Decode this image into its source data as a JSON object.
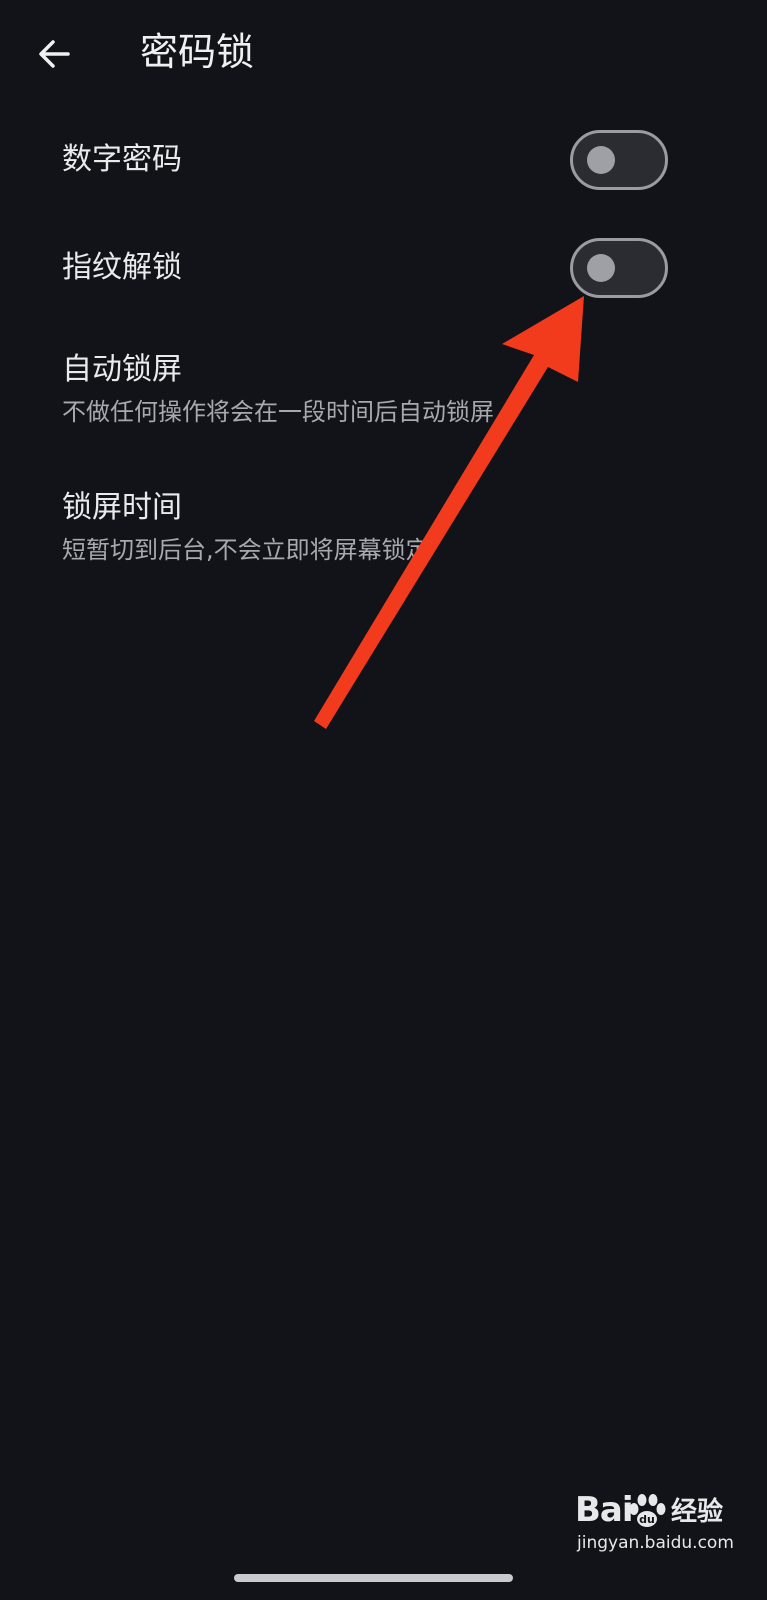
{
  "header": {
    "title": "密码锁",
    "back_icon": "arrow-left-icon"
  },
  "settings": [
    {
      "title": "数字密码",
      "toggle": true,
      "enabled": false
    },
    {
      "title": "指纹解锁",
      "toggle": true,
      "enabled": false
    },
    {
      "title": "自动锁屏",
      "subtitle": "不做任何操作将会在一段时间后自动锁屏"
    },
    {
      "title": "锁屏时间",
      "subtitle": "短暂切到后台,不会立即将屏幕锁定"
    }
  ],
  "annotation": {
    "arrow_color": "#f23a1c",
    "arrow_icon": "red-arrow-icon"
  },
  "watermark": {
    "brand": "Bai",
    "brand_suffix": "经验",
    "url": "jingyan.baidu.com"
  },
  "colors": {
    "background": "#111318",
    "toggle_off_border": "#9a9ca2",
    "toggle_off_knob": "#9ea0a6"
  }
}
